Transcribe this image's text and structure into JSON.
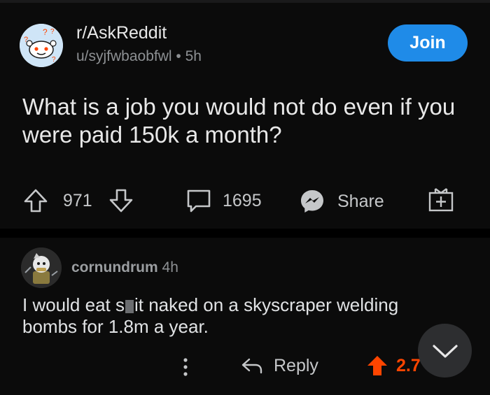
{
  "post": {
    "subreddit": "r/AskReddit",
    "author": "u/syjfwbaobfwl",
    "separator": "•",
    "age": "5h",
    "join_label": "Join",
    "title": "What is a job you would not do even if you were paid 150k a month?",
    "votes": "971",
    "comments": "1695",
    "share_label": "Share"
  },
  "comment": {
    "username": "cornundrum",
    "age": "4h",
    "body_part1": "I would eat s",
    "body_part2": "it naked on a skyscraper welding bombs for 1.8m a year.",
    "reply_label": "Reply",
    "votes": "2.7"
  },
  "colors": {
    "accent": "#1f8be8",
    "upvote": "#ff4500",
    "background": "#0b0b0b"
  },
  "icons": [
    "upvote-icon",
    "downvote-icon",
    "comment-icon",
    "messenger-icon",
    "award-icon",
    "more-icon",
    "reply-icon",
    "chevron-down-icon"
  ]
}
